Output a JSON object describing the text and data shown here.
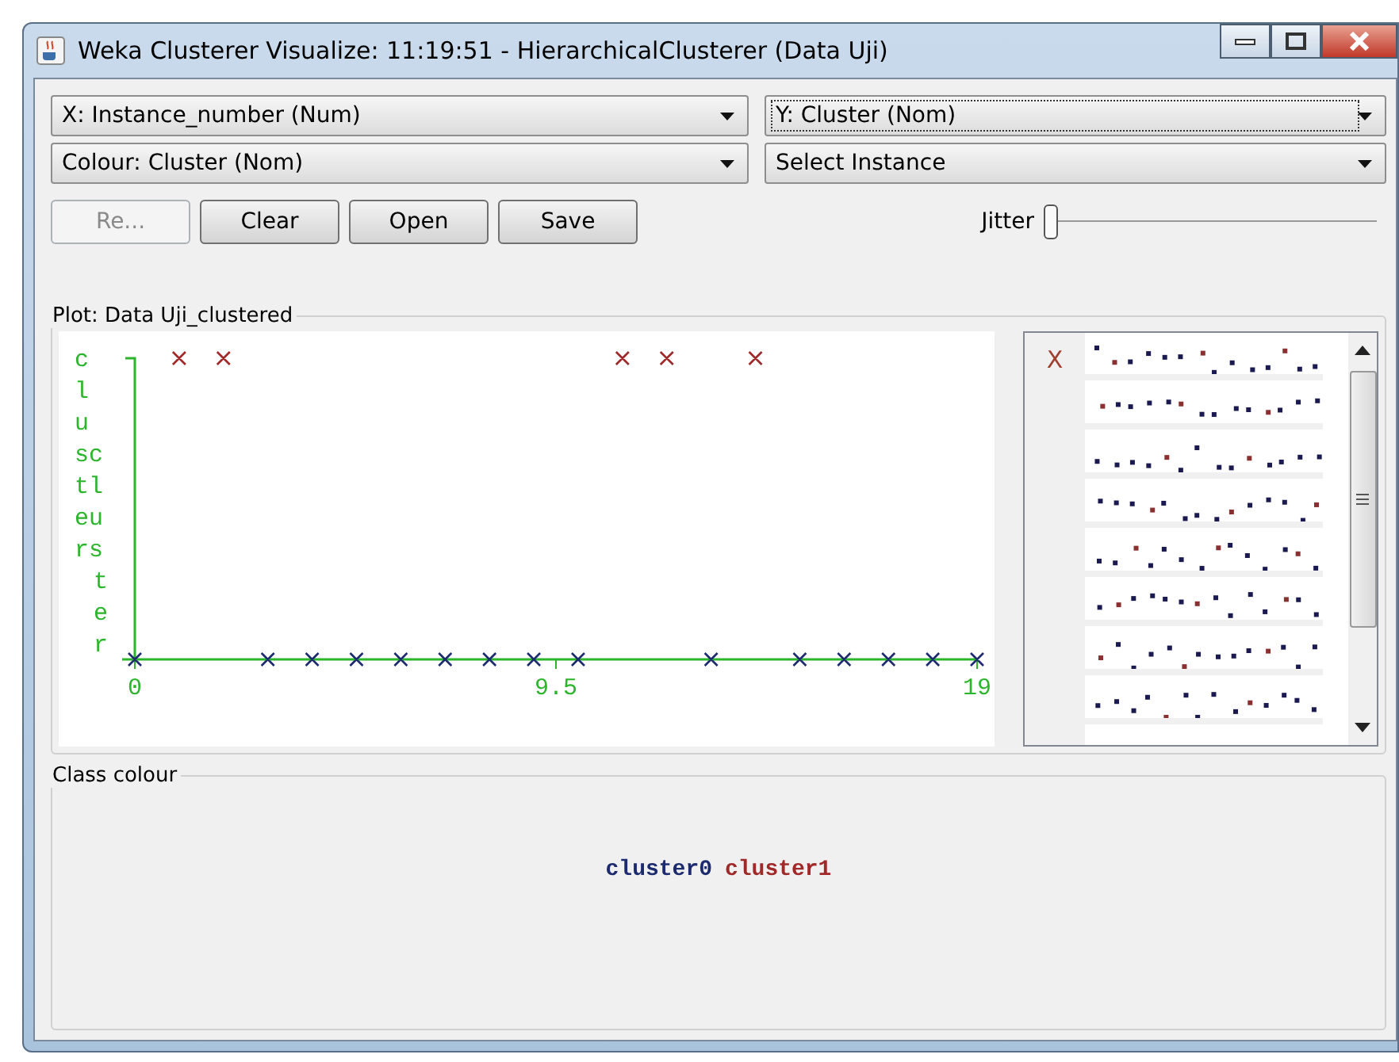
{
  "window": {
    "title": "Weka Clusterer Visualize: 11:19:51 - HierarchicalClusterer (Data Uji)"
  },
  "selectors": [
    {
      "value": "X: Instance_number (Num)",
      "focused": false
    },
    {
      "value": "Y: Cluster (Nom)",
      "focused": true
    },
    {
      "value": "Colour: Cluster (Nom)",
      "focused": false
    },
    {
      "value": "Select Instance",
      "focused": false
    }
  ],
  "buttons": [
    {
      "label": "Re...",
      "disabled": true
    },
    {
      "label": "Clear",
      "disabled": false
    },
    {
      "label": "Open",
      "disabled": false
    },
    {
      "label": "Save",
      "disabled": false
    }
  ],
  "jitter": {
    "label": "Jitter",
    "level": 0
  },
  "plot": {
    "title": "Plot: Data Uji_clustered",
    "y_axis_lines": [
      "c",
      "l",
      "u",
      "sc",
      "tl",
      "eu",
      "rs",
      "t",
      "e",
      "r"
    ],
    "x_tick_labels": [
      "0",
      "9.5",
      "19"
    ]
  },
  "matrix": {
    "row_label": "X"
  },
  "class_colour": {
    "title": "Class colour",
    "classes": [
      {
        "name": "cluster0",
        "color": "#1c2a6e"
      },
      {
        "name": "cluster1",
        "color": "#a02828"
      }
    ]
  }
}
